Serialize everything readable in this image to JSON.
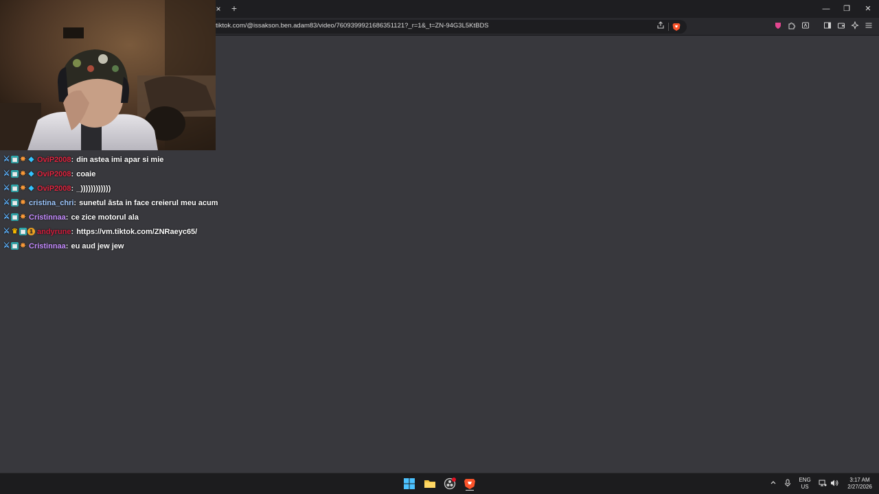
{
  "browser": {
    "url": "tiktok.com/@issakson.ben.adam83/video/7609399921686351121?_r=1&_t=ZN-94G3L5KtBDS",
    "tab_close_glyph": "×",
    "new_tab_glyph": "+",
    "window": {
      "minimize": "—",
      "restore": "❐",
      "close": "✕"
    }
  },
  "chat": {
    "messages": [
      {
        "badges": [
          "sword",
          "grid",
          "star",
          "gem"
        ],
        "user": "OviP2008",
        "user_color": "#e0243f",
        "text": "din astea imi apar si mie"
      },
      {
        "badges": [
          "sword",
          "grid",
          "star",
          "gem"
        ],
        "user": "OviP2008",
        "user_color": "#e0243f",
        "text": "coaie"
      },
      {
        "badges": [
          "sword",
          "grid",
          "star",
          "gem"
        ],
        "user": "OviP2008",
        "user_color": "#e0243f",
        "text": "_))))))))))))"
      },
      {
        "badges": [
          "sword",
          "grid",
          "star"
        ],
        "user": "cristina_chri",
        "user_color": "#9ec8ff",
        "text": "sunetul ăsta in face creierul meu acum"
      },
      {
        "badges": [
          "sword",
          "grid",
          "star"
        ],
        "user": "Cristinnaa",
        "user_color": "#c58cff",
        "text": "ce zice motorul ala"
      },
      {
        "badges": [
          "sword",
          "crown",
          "grid",
          "one"
        ],
        "user": "andyrune",
        "user_color": "#d01c3c",
        "text": "https://vm.tiktok.com/ZNRaeyc65/"
      },
      {
        "badges": [
          "sword",
          "grid",
          "star"
        ],
        "user": "Cristinnaa",
        "user_color": "#c58cff",
        "text": "eu aud jew jew"
      }
    ]
  },
  "taskbar": {
    "lang_top": "ENG",
    "lang_bottom": "US",
    "time": "3:17 AM",
    "date": "2/27/2026"
  },
  "colors": {
    "page_bg": "#38383d",
    "tabbar_bg": "#1e1e21",
    "taskbar_bg": "#1c1c1e"
  }
}
